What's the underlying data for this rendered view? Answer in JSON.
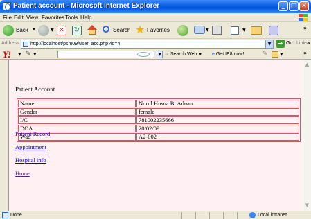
{
  "window": {
    "title": "Patient account - Microsoft Internet Explorer",
    "minimize": "_",
    "maximize": "□",
    "close": "✕"
  },
  "menu": [
    "File",
    "Edit",
    "View",
    "Favorites",
    "Tools",
    "Help"
  ],
  "toolbar": {
    "back": "Back",
    "search": "Search",
    "favorites": "Favorites",
    "more": "»"
  },
  "address": {
    "label": "Address",
    "url": "http://localhost/psm09/user_acc.php?id=4",
    "go": "Go",
    "links": "Links",
    "more": "»"
  },
  "yahoo": {
    "logo": "Y!",
    "search_web": "Search Web",
    "get_ie8": "Get IE8 now!",
    "more": "»"
  },
  "page": {
    "title": "Patient Account",
    "rows": [
      {
        "label": "Name",
        "value": "Nurul Husna Bt Adnan"
      },
      {
        "label": "Gender",
        "value": "female"
      },
      {
        "label": "I/C",
        "value": "781002235666"
      },
      {
        "label": "DOA",
        "value": "20/02/09"
      },
      {
        "label": "Wad",
        "value": "A2-002"
      }
    ],
    "links": {
      "patient_record": "Patient Record",
      "appointment": "Appointment",
      "hospital_info": "Hospital info",
      "home": "Home"
    }
  },
  "status": {
    "text": "Done",
    "zone": "Local intranet"
  }
}
